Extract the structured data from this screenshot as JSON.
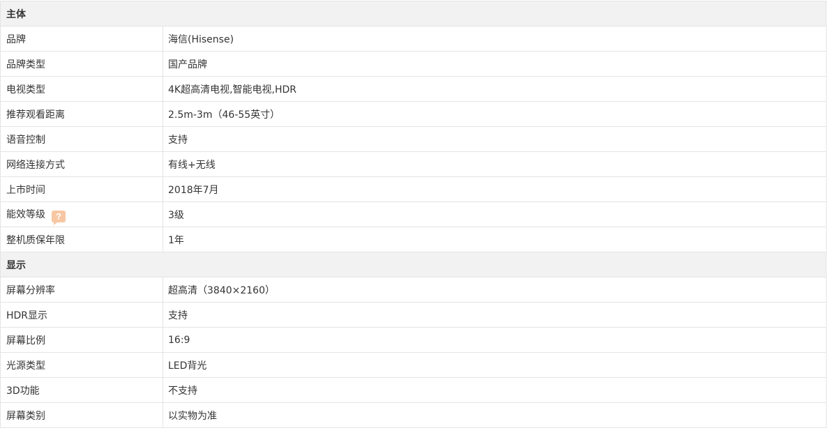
{
  "sections": [
    {
      "title": "主体",
      "rows": [
        {
          "label": "品牌",
          "value": "海信(Hisense)"
        },
        {
          "label": "品牌类型",
          "value": "国产品牌"
        },
        {
          "label": "电视类型",
          "value": "4K超高清电视,智能电视,HDR"
        },
        {
          "label": "推荐观看距离",
          "value": "2.5m-3m（46-55英寸）"
        },
        {
          "label": "语音控制",
          "value": "支持"
        },
        {
          "label": "网络连接方式",
          "value": "有线+无线"
        },
        {
          "label": "上市时间",
          "value": "2018年7月"
        },
        {
          "label": "能效等级",
          "value": "3级",
          "help_icon": "question-mark-icon",
          "help_glyph": "?"
        },
        {
          "label": "整机质保年限",
          "value": "1年"
        }
      ]
    },
    {
      "title": "显示",
      "rows": [
        {
          "label": "屏幕分辨率",
          "value": "超高清（3840×2160）"
        },
        {
          "label": "HDR显示",
          "value": "支持"
        },
        {
          "label": "屏幕比例",
          "value": "16:9"
        },
        {
          "label": "光源类型",
          "value": "LED背光"
        },
        {
          "label": "3D功能",
          "value": "不支持"
        },
        {
          "label": "屏幕类别",
          "value": "以实物为准"
        }
      ]
    }
  ],
  "colors": {
    "section_bg": "#f2f2f2",
    "border": "#e4e4e4",
    "text": "#333333",
    "help_icon_bg": "#f7c7a3"
  }
}
